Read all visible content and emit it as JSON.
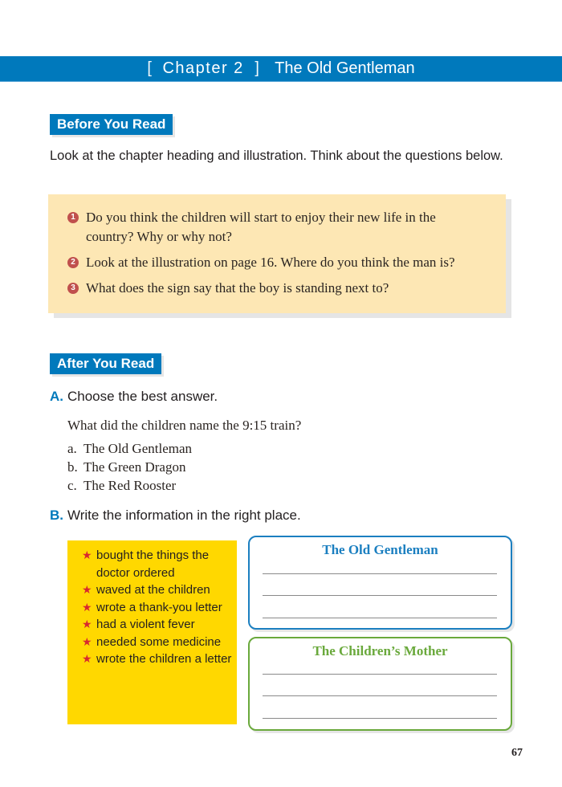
{
  "header": {
    "chapter_label": "Chapter 2",
    "bracket_open": "[",
    "bracket_close": "]",
    "title": "The Old Gentleman"
  },
  "before_you_read": {
    "tag": "Before You Read",
    "intro": "Look at the chapter heading and illustration. Think about the questions below.",
    "questions": [
      {
        "number": "1",
        "text": "Do you think the children will start to enjoy their new life in the country? Why or why not?"
      },
      {
        "number": "2",
        "text": "Look at the illustration on page 16. Where do you think the man is?"
      },
      {
        "number": "3",
        "text": "What does the sign say that the boy is standing next to?"
      }
    ]
  },
  "after_you_read": {
    "tag": "After You Read",
    "section_a": {
      "letter": "A.",
      "instruction": "Choose the best answer.",
      "question": "What did the children name the 9:15 train?",
      "options": [
        {
          "letter": "a.",
          "text": "The Old Gentleman"
        },
        {
          "letter": "b.",
          "text": "The Green Dragon"
        },
        {
          "letter": "c.",
          "text": "The Red Rooster"
        }
      ]
    },
    "section_b": {
      "letter": "B.",
      "instruction": "Write the information in the right place.",
      "items": [
        "bought the things the doctor ordered",
        "waved at the children",
        "wrote a thank-you letter",
        "had a violent fever",
        "needed some medicine",
        "wrote the children a letter"
      ],
      "bullet_icon": "★",
      "boxes": [
        {
          "title": "The Old Gentleman",
          "color": "#1b7fc0",
          "lines": 3
        },
        {
          "title": "The Children’s Mother",
          "color": "#6aa93c",
          "lines": 3
        }
      ]
    }
  },
  "page_number": "67",
  "colors": {
    "brand_blue": "#0079bc",
    "question_box": "#fde7b4",
    "yellow_box": "#ffd800",
    "number_circle": "#c0504d",
    "star": "#d7282f"
  }
}
